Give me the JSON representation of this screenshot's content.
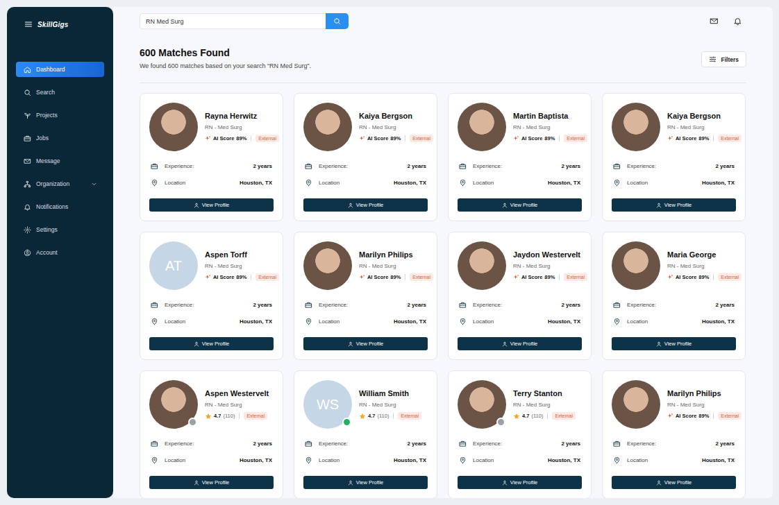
{
  "sidebar": {
    "logo": "SkillGigs",
    "items": [
      {
        "label": "Dashboard",
        "selected": true,
        "submenu": false
      },
      {
        "label": "Search",
        "selected": false,
        "submenu": false
      },
      {
        "label": "Projects",
        "selected": false,
        "submenu": false
      },
      {
        "label": "Jobs",
        "selected": false,
        "submenu": false
      },
      {
        "label": "Message",
        "selected": false,
        "submenu": false
      },
      {
        "label": "Organization",
        "selected": false,
        "submenu": true
      },
      {
        "label": "Notifications",
        "selected": false,
        "submenu": false
      },
      {
        "label": "Settings",
        "selected": false,
        "submenu": false
      },
      {
        "label": "Account",
        "selected": false,
        "submenu": false
      }
    ]
  },
  "search": {
    "value": "RN Med Surg"
  },
  "header": {
    "title": "600 Matches Found",
    "subtitle": "We found 600 matches based on your search “RN Med Surg”.",
    "filters": "Filters"
  },
  "cards": [
    {
      "name": "Rayna Herwitz",
      "role": "RN - Med Surg",
      "avatar": {
        "kind": "photo"
      },
      "kind": "ai-score",
      "score_label": "AI Score",
      "score": "89%",
      "tag": "External",
      "status_dot": false,
      "online": false,
      "experience_label": "Experience:",
      "experience": "2 years",
      "location_label": "Location",
      "location": "Houston, TX",
      "button": "View Profile"
    },
    {
      "name": "Kaiya Bergson",
      "role": "RN - Med Surg",
      "avatar": {
        "kind": "photo"
      },
      "kind": "ai-score",
      "score_label": "AI Score",
      "score": "89%",
      "tag": "External",
      "status_dot": false,
      "online": false,
      "experience_label": "Experience:",
      "experience": "2 years",
      "location_label": "Location",
      "location": "Houston, TX",
      "button": "View Profile"
    },
    {
      "name": "Martin Baptista",
      "role": "RN - Med Surg",
      "avatar": {
        "kind": "photo"
      },
      "kind": "ai-score",
      "score_label": "AI Score",
      "score": "89%",
      "tag": "External",
      "status_dot": false,
      "online": false,
      "experience_label": "Experience:",
      "experience": "2 years",
      "location_label": "Location",
      "location": "Houston, TX",
      "button": "View Profile"
    },
    {
      "name": "Kaiya Bergson",
      "role": "RN - Med Surg",
      "avatar": {
        "kind": "photo"
      },
      "kind": "ai-score",
      "score_label": "AI Score",
      "score": "89%",
      "tag": "External",
      "status_dot": false,
      "online": false,
      "experience_label": "Experience:",
      "experience": "2 years",
      "location_label": "Location",
      "location": "Houston, TX",
      "button": "View Profile"
    },
    {
      "name": "Aspen Torff",
      "role": "RN - Med Surg",
      "avatar": {
        "kind": "initials",
        "text": "AT"
      },
      "kind": "ai-score",
      "score_label": "AI Score",
      "score": "89%",
      "tag": "External",
      "status_dot": false,
      "online": false,
      "experience_label": "Experience:",
      "experience": "2 years",
      "location_label": "Location",
      "location": "Houston, TX",
      "button": "View Profile"
    },
    {
      "name": "Marilyn Philips",
      "role": "RN - Med Surg",
      "avatar": {
        "kind": "photo"
      },
      "kind": "ai-score",
      "score_label": "AI Score",
      "score": "89%",
      "tag": "External",
      "status_dot": false,
      "online": false,
      "experience_label": "Experience:",
      "experience": "2 years",
      "location_label": "Location",
      "location": "Houston, TX",
      "button": "View Profile"
    },
    {
      "name": "Jaydon Westervelt",
      "role": "RN - Med Surg",
      "avatar": {
        "kind": "photo"
      },
      "kind": "ai-score",
      "score_label": "AI Score",
      "score": "89%",
      "tag": "External",
      "status_dot": false,
      "online": false,
      "experience_label": "Experience:",
      "experience": "2 years",
      "location_label": "Location",
      "location": "Houston, TX",
      "button": "View Profile"
    },
    {
      "name": "Maria George",
      "role": "RN - Med Surg",
      "avatar": {
        "kind": "photo"
      },
      "kind": "ai-score",
      "score_label": "AI Score",
      "score": "89%",
      "tag": "External",
      "status_dot": false,
      "online": false,
      "experience_label": "Experience:",
      "experience": "2 years",
      "location_label": "Location",
      "location": "Houston, TX",
      "button": "View Profile"
    },
    {
      "name": "Aspen Westervelt",
      "role": "RN - Med Surg",
      "avatar": {
        "kind": "photo"
      },
      "kind": "rating",
      "rating": "4.7",
      "reviews": "(110)",
      "tag": "External",
      "status_dot": true,
      "online": false,
      "experience_label": "Experience:",
      "experience": "2 years",
      "location_label": "Location",
      "location": "Houston, TX",
      "button": "View Profile"
    },
    {
      "name": "William Smith",
      "role": "RN - Med Surg",
      "avatar": {
        "kind": "initials",
        "text": "WS"
      },
      "kind": "rating",
      "rating": "4.7",
      "reviews": "(110)",
      "tag": "External",
      "status_dot": true,
      "online": true,
      "experience_label": "Experience:",
      "experience": "2 years",
      "location_label": "Location",
      "location": "Houston, TX",
      "button": "View Profile"
    },
    {
      "name": "Terry Stanton",
      "role": "RN - Med Surg",
      "avatar": {
        "kind": "photo"
      },
      "kind": "rating",
      "rating": "4.7",
      "reviews": "(110)",
      "tag": "External",
      "status_dot": true,
      "online": false,
      "experience_label": "Experience:",
      "experience": "2 years",
      "location_label": "Location",
      "location": "Houston, TX",
      "button": "View Profile"
    },
    {
      "name": "Marilyn Philips",
      "role": "RN - Med Surg",
      "avatar": {
        "kind": "photo"
      },
      "kind": "ai-score",
      "score_label": "AI Score",
      "score": "89%",
      "tag": "External",
      "status_dot": false,
      "online": false,
      "experience_label": "Experience:",
      "experience": "2 years",
      "location_label": "Location",
      "location": "Houston, TX",
      "button": "View Profile"
    }
  ]
}
